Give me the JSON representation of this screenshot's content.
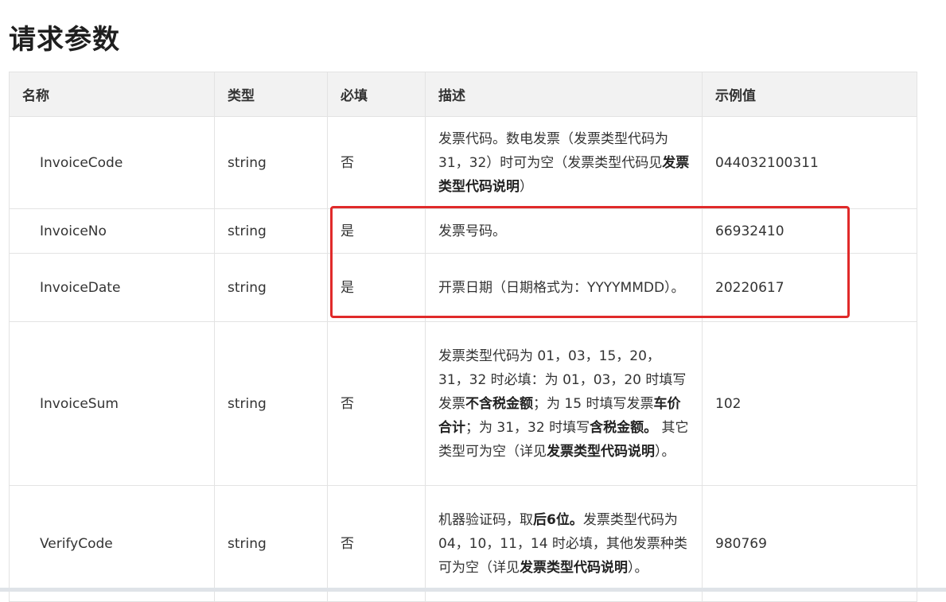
{
  "page": {
    "title": "请求参数"
  },
  "table": {
    "headers": [
      "名称",
      "类型",
      "必填",
      "描述",
      "示例值"
    ],
    "rows": [
      {
        "name": "InvoiceCode",
        "type": "string",
        "required": "否",
        "desc": [
          {
            "text": "发票代码。数电发票（发票类型代码为 31，32）时可为空（发票类型代码见",
            "bold": false
          },
          {
            "text": "发票类型代码说明",
            "bold": true
          },
          {
            "text": "）",
            "bold": false
          }
        ],
        "example": "044032100311"
      },
      {
        "name": "InvoiceNo",
        "type": "string",
        "required": "是",
        "desc": [
          {
            "text": "发票号码。",
            "bold": false
          }
        ],
        "example": "66932410"
      },
      {
        "name": "InvoiceDate",
        "type": "string",
        "required": "是",
        "desc": [
          {
            "text": "开票日期（日期格式为：YYYYMMDD）。",
            "bold": false
          }
        ],
        "example": "20220617"
      },
      {
        "name": "InvoiceSum",
        "type": "string",
        "required": "否",
        "desc": [
          {
            "text": "发票类型代码为 01，03，15，20，31，32 时必填：为 01，03，20 时填写发票",
            "bold": false
          },
          {
            "text": "不含税金额",
            "bold": true
          },
          {
            "text": "；为 15 时填写发票",
            "bold": false
          },
          {
            "text": "车价合计",
            "bold": true
          },
          {
            "text": "；为 31，32 时填写",
            "bold": false
          },
          {
            "text": "含税金额。",
            "bold": true
          },
          {
            "text": " 其它类型可为空（详见",
            "bold": false
          },
          {
            "text": "发票类型代码说明",
            "bold": true
          },
          {
            "text": "）。",
            "bold": false
          }
        ],
        "example": "102"
      },
      {
        "name": "VerifyCode",
        "type": "string",
        "required": "否",
        "desc": [
          {
            "text": "机器验证码，取",
            "bold": false
          },
          {
            "text": "后6位。",
            "bold": true
          },
          {
            "text": "发票类型代码为 04，10，11，14 时必填，其他发票种类可为空（详见",
            "bold": false
          },
          {
            "text": "发票类型代码说明",
            "bold": true
          },
          {
            "text": "）。",
            "bold": false
          }
        ],
        "example": "980769"
      }
    ]
  }
}
